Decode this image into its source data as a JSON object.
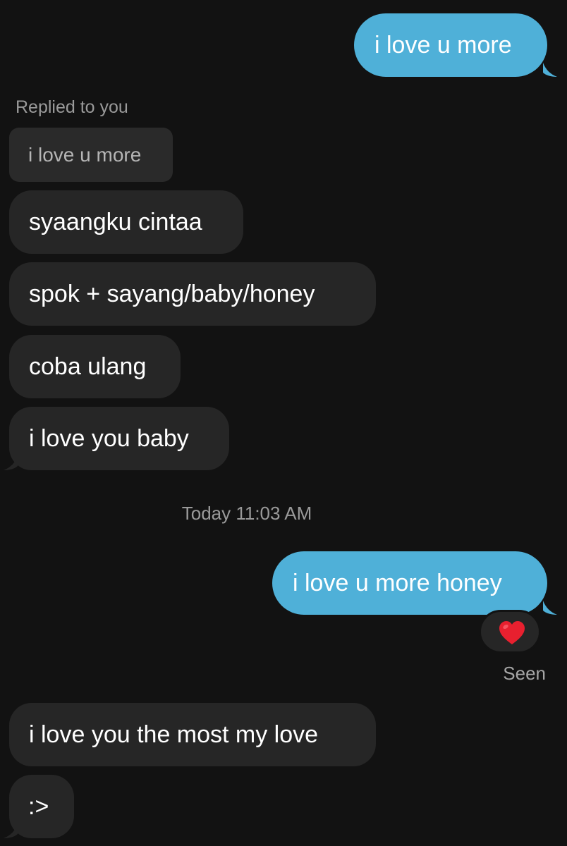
{
  "colors": {
    "background": "#121212",
    "outgoing_bubble": "#4fb0d8",
    "incoming_bubble": "#262626",
    "quoted_bubble": "#2a2a2a",
    "meta_text": "#9a9a9a",
    "heart": "#e8202f"
  },
  "messages": {
    "m1": {
      "direction": "outgoing",
      "text": "i love u more"
    },
    "reply": {
      "label": "Replied to you",
      "quoted_text": "i love u more"
    },
    "m2": {
      "direction": "incoming",
      "text": "syaangku cintaa"
    },
    "m3": {
      "direction": "incoming",
      "text": "spok + sayang/baby/honey"
    },
    "m4": {
      "direction": "incoming",
      "text": "coba ulang"
    },
    "m5": {
      "direction": "incoming",
      "text": "i love you baby"
    },
    "timestamp": "Today 11:03 AM",
    "m6": {
      "direction": "outgoing",
      "text": "i love u more honey",
      "reaction": "heart-icon"
    },
    "status": "Seen",
    "m7": {
      "direction": "incoming",
      "text": "i love you the most my love"
    },
    "m8": {
      "direction": "incoming",
      "text": ":>"
    }
  }
}
